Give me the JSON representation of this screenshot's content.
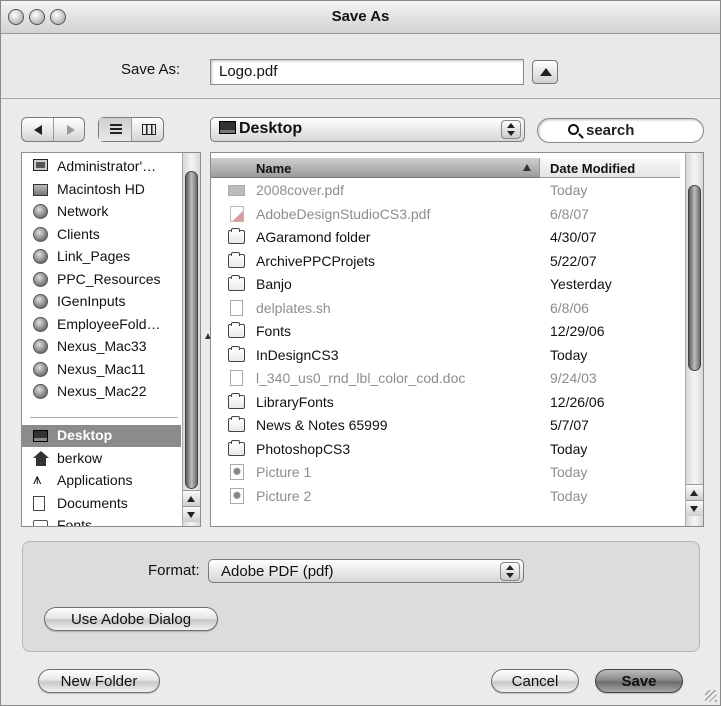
{
  "window": {
    "title": "Save As"
  },
  "save_as": {
    "label": "Save As:",
    "filename": "Logo.pdf"
  },
  "location_popup": {
    "value": "Desktop"
  },
  "search": {
    "prefix": "Q",
    "placeholder": "search"
  },
  "sidebar": {
    "items": [
      {
        "label": "Administrator'…",
        "icon": "monitor-icon",
        "selected": false
      },
      {
        "label": "Macintosh HD",
        "icon": "hard-disk-icon",
        "selected": false
      },
      {
        "label": "Network",
        "icon": "globe-icon",
        "selected": false
      },
      {
        "label": "Clients",
        "icon": "network-volume-icon",
        "selected": false
      },
      {
        "label": "Link_Pages",
        "icon": "network-volume-icon",
        "selected": false
      },
      {
        "label": "PPC_Resources",
        "icon": "network-volume-icon",
        "selected": false
      },
      {
        "label": "IGenInputs",
        "icon": "network-volume-icon",
        "selected": false
      },
      {
        "label": "EmployeeFold…",
        "icon": "network-volume-icon",
        "selected": false
      },
      {
        "label": "Nexus_Mac33",
        "icon": "network-volume-icon",
        "selected": false
      },
      {
        "label": "Nexus_Mac11",
        "icon": "network-volume-icon",
        "selected": false
      },
      {
        "label": "Nexus_Mac22",
        "icon": "network-volume-icon",
        "selected": false
      },
      {
        "label": "Desktop",
        "icon": "desktop-icon",
        "selected": true
      },
      {
        "label": "berkow",
        "icon": "home-icon",
        "selected": false
      },
      {
        "label": "Applications",
        "icon": "applications-icon",
        "selected": false
      },
      {
        "label": "Documents",
        "icon": "document-icon",
        "selected": false
      },
      {
        "label": "Fonts",
        "icon": "folder-icon",
        "selected": false
      }
    ]
  },
  "file_list": {
    "columns": {
      "name": "Name",
      "date": "Date Modified"
    },
    "rows": [
      {
        "name": "2008cover.pdf",
        "date": "Today",
        "icon": "image-file-icon",
        "enabled": false
      },
      {
        "name": "AdobeDesignStudioCS3.pdf",
        "date": "6/8/07",
        "icon": "pdf-file-icon",
        "enabled": false
      },
      {
        "name": "AGaramond folder",
        "date": "4/30/07",
        "icon": "folder-icon",
        "enabled": true
      },
      {
        "name": "ArchivePPCProjets",
        "date": "5/22/07",
        "icon": "folder-icon",
        "enabled": true
      },
      {
        "name": "Banjo",
        "date": "Yesterday",
        "icon": "folder-icon",
        "enabled": true
      },
      {
        "name": "delplates.sh",
        "date": "6/8/06",
        "icon": "script-file-icon",
        "enabled": false
      },
      {
        "name": "Fonts",
        "date": "12/29/06",
        "icon": "folder-icon",
        "enabled": true
      },
      {
        "name": "InDesignCS3",
        "date": "Today",
        "icon": "folder-icon",
        "enabled": true
      },
      {
        "name": "l_340_us0_rnd_lbl_color_cod.doc",
        "date": "9/24/03",
        "icon": "document-file-icon",
        "enabled": false
      },
      {
        "name": "LibraryFonts",
        "date": "12/26/06",
        "icon": "folder-icon",
        "enabled": true
      },
      {
        "name": "News & Notes 65999",
        "date": "5/7/07",
        "icon": "folder-icon",
        "enabled": true
      },
      {
        "name": "PhotoshopCS3",
        "date": "Today",
        "icon": "folder-icon",
        "enabled": true
      },
      {
        "name": "Picture 1",
        "date": "Today",
        "icon": "picture-file-icon",
        "enabled": false
      },
      {
        "name": "Picture 2",
        "date": "Today",
        "icon": "picture-file-icon",
        "enabled": false
      }
    ]
  },
  "format": {
    "label": "Format:",
    "value": "Adobe PDF (pdf)"
  },
  "buttons": {
    "use_adobe_dialog": "Use Adobe Dialog",
    "new_folder": "New Folder",
    "cancel": "Cancel",
    "save": "Save"
  }
}
